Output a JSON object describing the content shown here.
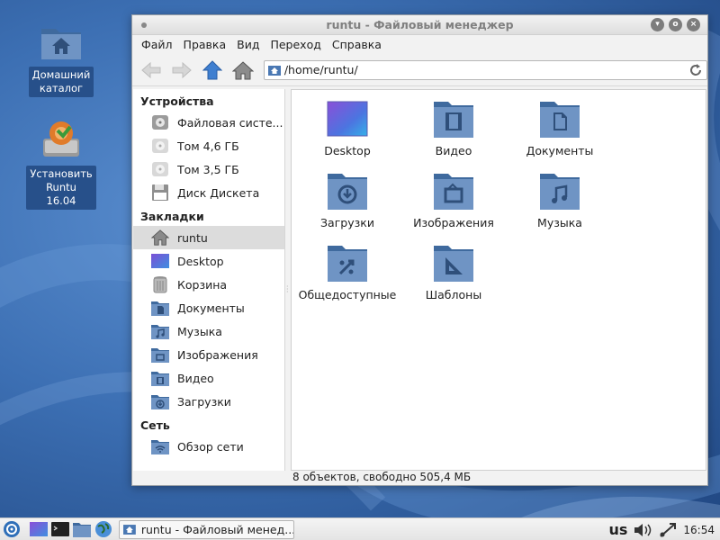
{
  "desktop": {
    "icons": [
      {
        "label": "Домашний\nкаталог"
      },
      {
        "label": "Установить\nRuntu 16.04"
      }
    ]
  },
  "window": {
    "title": "runtu - Файловый менеджер",
    "buttons": {
      "minimize": "▾",
      "maximize": "o",
      "close": "×"
    }
  },
  "menubar": [
    "Файл",
    "Правка",
    "Вид",
    "Переход",
    "Справка"
  ],
  "toolbar": {
    "address": "/home/runtu/"
  },
  "sidebar": {
    "devices_header": "Устройства",
    "devices": [
      "Файловая систе...",
      "Том 4,6 ГБ",
      "Том 3,5 ГБ",
      "Диск Дискета"
    ],
    "bookmarks_header": "Закладки",
    "bookmarks": [
      "runtu",
      "Desktop",
      "Корзина",
      "Документы",
      "Музыка",
      "Изображения",
      "Видео",
      "Загрузки"
    ],
    "network_header": "Сеть",
    "network": [
      "Обзор сети"
    ]
  },
  "files": [
    {
      "name": "Desktop",
      "icon": "desktop-folder"
    },
    {
      "name": "Видео",
      "icon": "video-folder"
    },
    {
      "name": "Документы",
      "icon": "documents-folder"
    },
    {
      "name": "Загрузки",
      "icon": "downloads-folder"
    },
    {
      "name": "Изображения",
      "icon": "pictures-folder"
    },
    {
      "name": "Музыка",
      "icon": "music-folder"
    },
    {
      "name": "Общедоступные",
      "icon": "public-folder"
    },
    {
      "name": "Шаблоны",
      "icon": "templates-folder"
    }
  ],
  "status": "8 объектов, свободно 505,4 МБ",
  "taskbar": {
    "task_title": "runtu - Файловый менед...",
    "keyboard": "us",
    "clock": "16:54"
  },
  "colors": {
    "folder": "#6f94c4",
    "folder_dark": "#3f6a9e",
    "accent_blue": "#3f7fd0",
    "desktop_bg": "#3c6fb3"
  }
}
